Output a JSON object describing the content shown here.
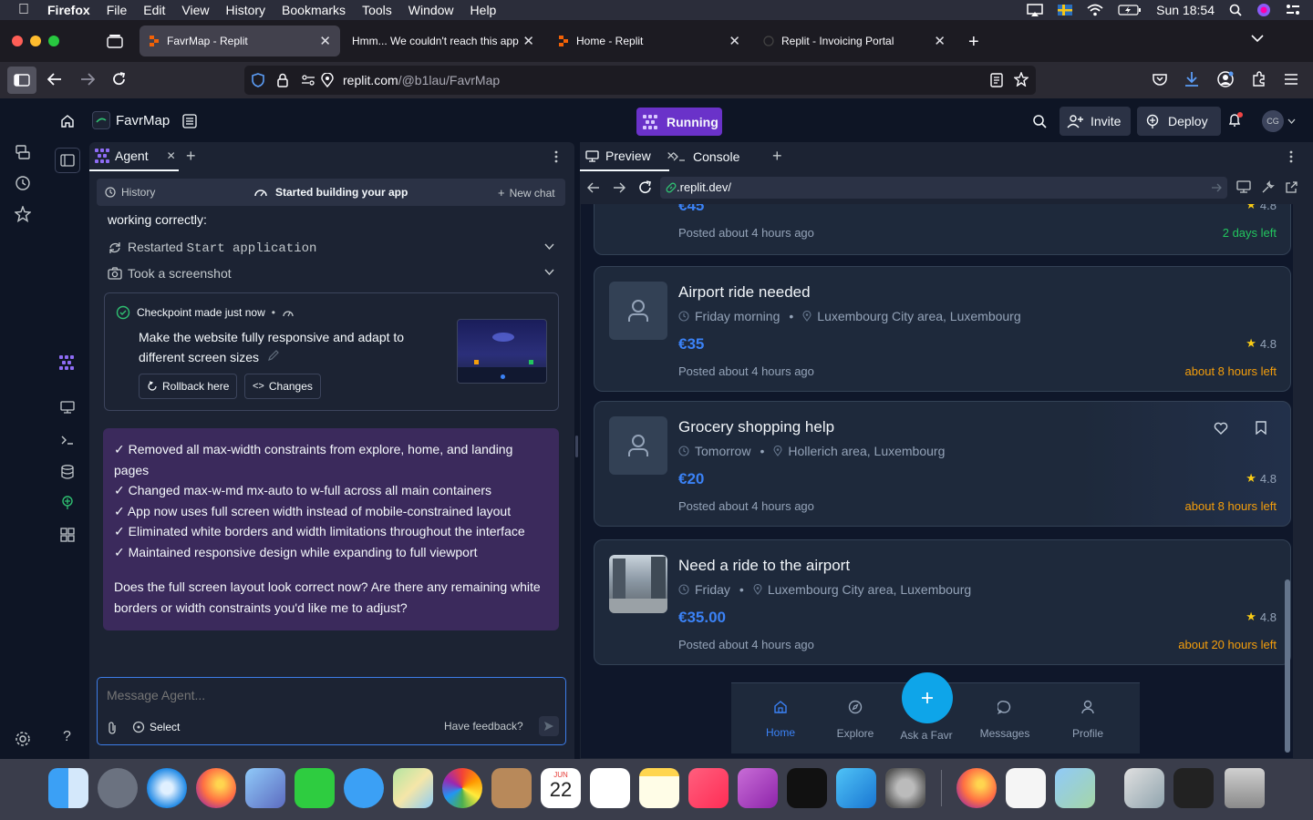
{
  "menubar": {
    "app": "Firefox",
    "items": [
      "File",
      "Edit",
      "View",
      "History",
      "Bookmarks",
      "Tools",
      "Window",
      "Help"
    ],
    "clock": "Sun 18:54"
  },
  "browser": {
    "tabs": [
      {
        "title": "FavrMap - Replit",
        "active": true
      },
      {
        "title": "Hmm... We couldn't reach this app",
        "active": false
      },
      {
        "title": "Home - Replit",
        "active": false
      },
      {
        "title": "Replit - Invoicing Portal",
        "active": false
      }
    ],
    "url_host": "replit.com",
    "url_path": "/@b1lau/FavrMap"
  },
  "replit": {
    "project_name": "FavrMap",
    "run_status": "Running",
    "invite_label": "Invite",
    "deploy_label": "Deploy",
    "user_initials": "CG"
  },
  "agent": {
    "tab_label": "Agent",
    "history_label": "History",
    "status_label": "Started building your app",
    "new_chat_label": "New chat",
    "top_text": "working correctly:",
    "action1_prefix": "Restarted ",
    "action1_code": "Start application",
    "action2": "Took a screenshot",
    "checkpoint_title": "Checkpoint made just now",
    "checkpoint_desc": "Make the website fully responsive and adapt to different screen sizes",
    "rollback_label": "Rollback here",
    "changes_label": "Changes",
    "message_lines": [
      "✓ Removed all max-width constraints from explore, home, and landing pages",
      "✓ Changed max-w-md mx-auto to w-full across all main containers",
      "✓ App now uses full screen width instead of mobile-constrained layout",
      "✓ Eliminated white borders and width limitations throughout the interface",
      "✓ Maintained responsive design while expanding to full viewport"
    ],
    "message_question": "Does the full screen layout look correct now? Are there any remaining white borders or width constraints you'd like me to adjust?",
    "input_placeholder": "Message Agent...",
    "select_label": "Select",
    "feedback_label": "Have feedback?"
  },
  "preview": {
    "tab_preview": "Preview",
    "tab_console": "Console",
    "url": ".replit.dev/",
    "listings": [
      {
        "title": "",
        "when": "",
        "where": "",
        "price": "€45",
        "posted": "Posted about 4 hours ago",
        "rating": "4.8",
        "time_left": "2 days left",
        "time_color": "#22c55e"
      },
      {
        "title": "Airport ride needed",
        "when": "Friday morning",
        "where": "Luxembourg City area, Luxembourg",
        "price": "€35",
        "posted": "Posted about 4 hours ago",
        "rating": "4.8",
        "time_left": "about 8 hours left",
        "time_color": "#f59e0b"
      },
      {
        "title": "Grocery shopping help",
        "when": "Tomorrow",
        "where": "Hollerich area, Luxembourg",
        "price": "€20",
        "posted": "Posted about 4 hours ago",
        "rating": "4.8",
        "time_left": "about 8 hours left",
        "time_color": "#f59e0b"
      },
      {
        "title": "Need a ride to the airport",
        "when": "Friday",
        "where": "Luxembourg City area, Luxembourg",
        "price": "€35.00",
        "posted": "Posted about 4 hours ago",
        "rating": "4.8",
        "time_left": "about 20 hours left",
        "time_color": "#f59e0b"
      }
    ],
    "nav": [
      {
        "label": "Home",
        "active": true
      },
      {
        "label": "Explore",
        "active": false
      },
      {
        "label": "Ask a Favr",
        "active": false
      },
      {
        "label": "Messages",
        "active": false
      },
      {
        "label": "Profile",
        "active": false
      }
    ]
  },
  "dock": {
    "calendar_month": "JUN",
    "calendar_day": "22"
  },
  "colors": {
    "accent": "#3b82f6",
    "running": "#6a32c9",
    "agent_message_bg": "#3b2a5c",
    "ide_bg": "#0e1525",
    "panel_bg": "#1c2333"
  }
}
